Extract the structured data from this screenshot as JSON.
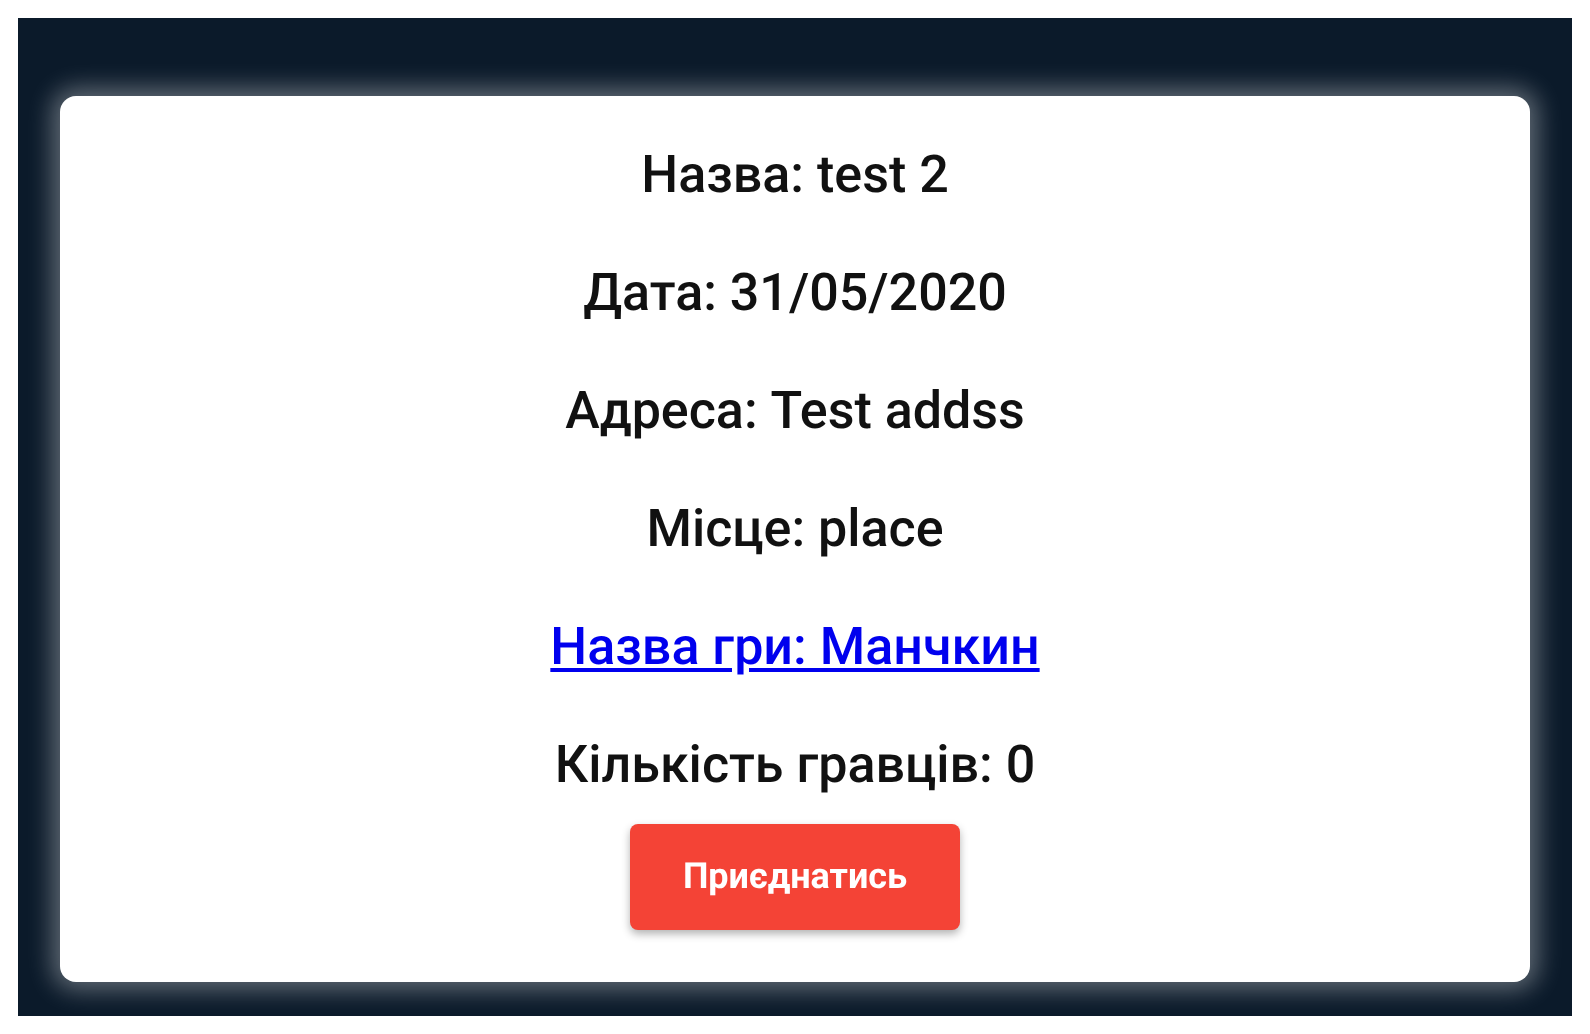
{
  "details": [
    {
      "kind": "text",
      "text": "Назва: test 2"
    },
    {
      "kind": "text",
      "text": "Дата: 31/05/2020"
    },
    {
      "kind": "text",
      "text": "Адреса: Test addss"
    },
    {
      "kind": "text",
      "text": "Місце: place"
    },
    {
      "kind": "link",
      "text": "Назва гри: Манчкин"
    },
    {
      "kind": "text",
      "text": "Кількість гравців: 0"
    }
  ],
  "join_button": "Приєднатись"
}
